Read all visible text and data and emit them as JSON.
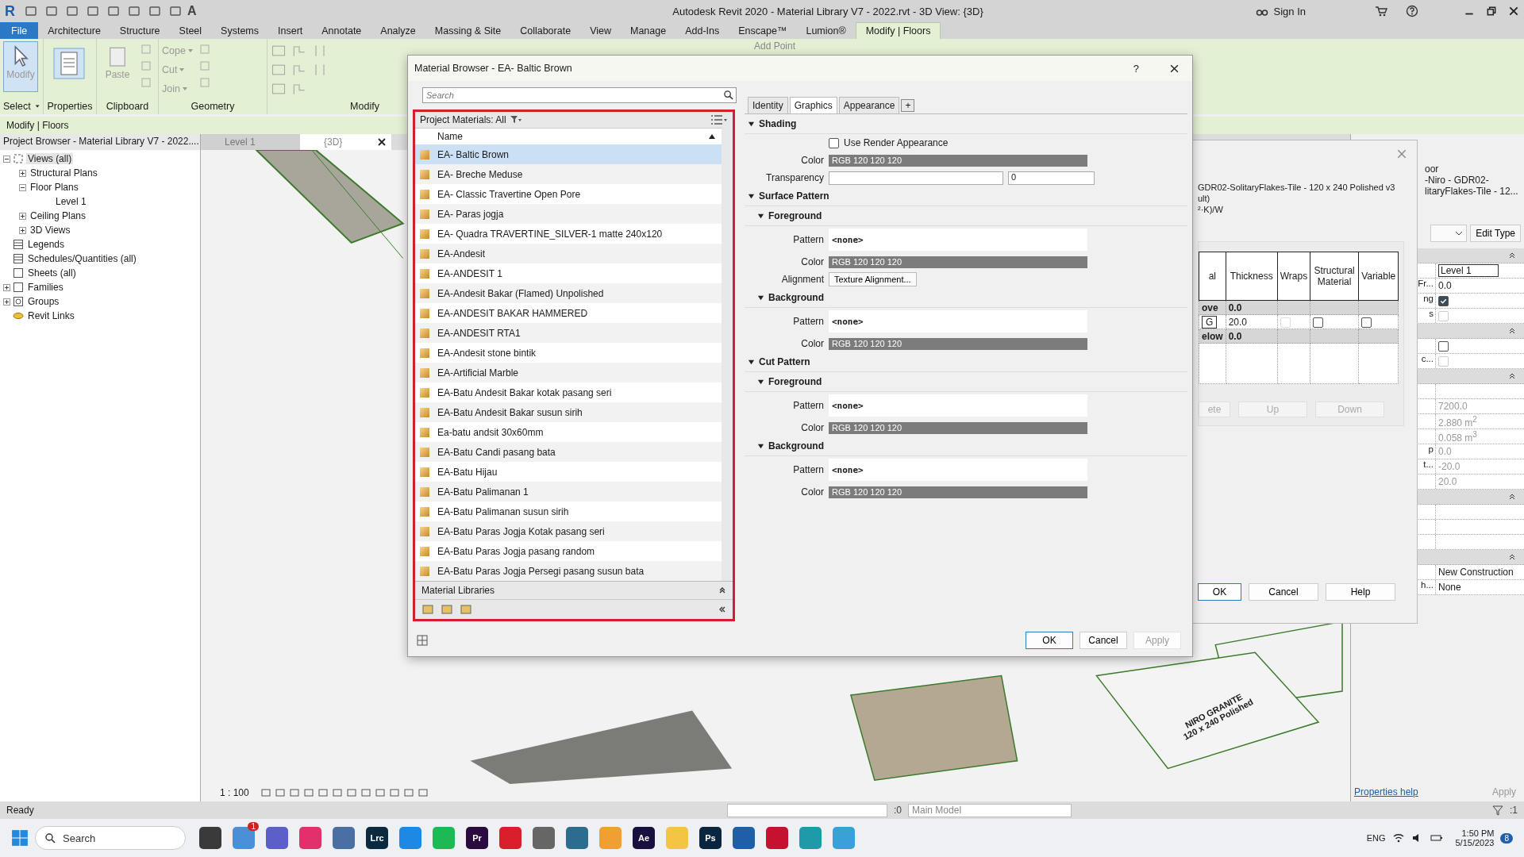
{
  "title_bar": {
    "logo": "R",
    "text_tool": "A",
    "title": "Autodesk Revit 2020 - Material Library V7 - 2022.rvt - 3D View: {3D}",
    "sign_in": "Sign In"
  },
  "ribbon_tabs": [
    {
      "label": "File",
      "kind": "file",
      "selected": false
    },
    {
      "label": "Architecture",
      "kind": "tab",
      "selected": false
    },
    {
      "label": "Structure",
      "kind": "tab",
      "selected": false
    },
    {
      "label": "Steel",
      "kind": "tab",
      "selected": false
    },
    {
      "label": "Systems",
      "kind": "tab",
      "selected": false
    },
    {
      "label": "Insert",
      "kind": "tab",
      "selected": false
    },
    {
      "label": "Annotate",
      "kind": "tab",
      "selected": false
    },
    {
      "label": "Analyze",
      "kind": "tab",
      "selected": false
    },
    {
      "label": "Massing & Site",
      "kind": "tab",
      "selected": false
    },
    {
      "label": "Collaborate",
      "kind": "tab",
      "selected": false
    },
    {
      "label": "View",
      "kind": "tab",
      "selected": false
    },
    {
      "label": "Manage",
      "kind": "tab",
      "selected": false
    },
    {
      "label": "Add-Ins",
      "kind": "tab",
      "selected": false
    },
    {
      "label": "Enscape™",
      "kind": "tab",
      "selected": false
    },
    {
      "label": "Lumion®",
      "kind": "tab",
      "selected": false
    },
    {
      "label": "Modify | Floors",
      "kind": "tab",
      "selected": true
    }
  ],
  "ribbon_panels": [
    {
      "label": "Select",
      "kind": "select",
      "tool": "Modify"
    },
    {
      "label": "Properties",
      "kind": "properties"
    },
    {
      "label": "Clipboard",
      "kind": "clipboard",
      "tool": "Paste"
    },
    {
      "label": "Geometry",
      "kind": "geometry",
      "small_tools": [
        "Cope",
        "Cut",
        "Join"
      ]
    },
    {
      "label": "Modify",
      "kind": "modify"
    }
  ],
  "ribbon_extra": "Add Point",
  "options_bar": "Modify | Floors",
  "project_browser": {
    "title": "Project Browser - Material Library V7 - 2022....",
    "tree": [
      {
        "label": "Views (all)",
        "kind": "views",
        "expanded": true,
        "selected": true,
        "children": [
          {
            "label": "Structural Plans",
            "expanded": false,
            "selected": false
          },
          {
            "label": "Floor Plans",
            "expanded": true,
            "selected": false,
            "children": [
              {
                "label": "Level 1",
                "selected": false
              }
            ]
          },
          {
            "label": "Ceiling Plans",
            "expanded": false,
            "selected": false
          },
          {
            "label": "3D Views",
            "expanded": false,
            "selected": false
          }
        ]
      },
      {
        "label": "Legends",
        "kind": "legend",
        "selected": false
      },
      {
        "label": "Schedules/Quantities (all)",
        "kind": "schedule",
        "selected": false
      },
      {
        "label": "Sheets (all)",
        "kind": "sheet",
        "selected": false
      },
      {
        "label": "Families",
        "kind": "family",
        "expanded": false,
        "selected": false
      },
      {
        "label": "Groups",
        "kind": "group",
        "expanded": false,
        "selected": false
      },
      {
        "label": "Revit Links",
        "kind": "link",
        "selected": false
      }
    ]
  },
  "view_tabs": [
    {
      "label": "Level 1",
      "selected": false
    },
    {
      "label": "{3D}",
      "selected": true
    }
  ],
  "view": {
    "tag_lines": [
      "NIRO GRANITE",
      "120 x 240 Polished"
    ],
    "scale": "1 : 100"
  },
  "material_browser": {
    "title": "Material Browser - EA- Baltic Brown",
    "help": "?",
    "search": {
      "placeholder": "Search"
    },
    "library_header": "Project Materials: All",
    "column": "Name",
    "materials": [
      {
        "name": "EA- Baltic Brown",
        "selected": true
      },
      {
        "name": "EA- Breche Meduse",
        "selected": false
      },
      {
        "name": "EA- Classic Travertine Open Pore",
        "selected": false
      },
      {
        "name": "EA- Paras jogja",
        "selected": false
      },
      {
        "name": "EA- Quadra TRAVERTINE_SILVER-1 matte 240x120",
        "selected": false
      },
      {
        "name": "EA-Andesit",
        "selected": false
      },
      {
        "name": "EA-ANDESIT 1",
        "selected": false
      },
      {
        "name": "EA-Andesit Bakar (Flamed) Unpolished",
        "selected": false
      },
      {
        "name": "EA-ANDESIT BAKAR HAMMERED",
        "selected": false
      },
      {
        "name": "EA-ANDESIT RTA1",
        "selected": false
      },
      {
        "name": "EA-Andesit stone bintik",
        "selected": false
      },
      {
        "name": "EA-Artificial Marble",
        "selected": false
      },
      {
        "name": "EA-Batu Andesit Bakar kotak pasang seri",
        "selected": false
      },
      {
        "name": "EA-Batu Andesit Bakar susun sirih",
        "selected": false
      },
      {
        "name": "Ea-batu andsit 30x60mm",
        "selected": false
      },
      {
        "name": "EA-Batu Candi pasang bata",
        "selected": false
      },
      {
        "name": "EA-Batu Hijau",
        "selected": false
      },
      {
        "name": "EA-Batu Palimanan 1",
        "selected": false
      },
      {
        "name": "EA-Batu Palimanan susun sirih",
        "selected": false
      },
      {
        "name": "EA-Batu Paras Jogja Kotak pasang seri",
        "selected": false
      },
      {
        "name": "EA-Batu Paras Jogja pasang random",
        "selected": false
      },
      {
        "name": "EA-Batu Paras Jogja Persegi pasang susun bata",
        "selected": false
      }
    ],
    "libraries": "Material Libraries",
    "tabs": [
      {
        "label": "Identity",
        "selected": false
      },
      {
        "label": "Graphics",
        "selected": true
      },
      {
        "label": "Appearance",
        "selected": false
      }
    ],
    "add_tab": "+",
    "sections": [
      {
        "title": "Shading",
        "expanded": true,
        "rows": [
          {
            "kind": "checkbox",
            "label": "Use Render Appearance",
            "checked": false
          },
          {
            "kind": "color",
            "label": "Color",
            "value": "RGB 120 120 120"
          },
          {
            "kind": "slider",
            "label": "Transparency",
            "value": "0",
            "level": 0
          }
        ]
      },
      {
        "title": "Surface Pattern",
        "expanded": true,
        "groups": [
          {
            "title": "Foreground",
            "expanded": true,
            "rows": [
              {
                "kind": "pattern",
                "label": "Pattern",
                "value": "<none>"
              },
              {
                "kind": "color",
                "label": "Color",
                "value": "RGB 120 120 120"
              },
              {
                "kind": "button",
                "label": "Alignment",
                "value": "Texture Alignment..."
              }
            ]
          },
          {
            "title": "Background",
            "expanded": true,
            "rows": [
              {
                "kind": "pattern",
                "label": "Pattern",
                "value": "<none>"
              },
              {
                "kind": "color",
                "label": "Color",
                "value": "RGB 120 120 120"
              }
            ]
          }
        ]
      },
      {
        "title": "Cut Pattern",
        "expanded": true,
        "groups": [
          {
            "title": "Foreground",
            "expanded": true,
            "rows": [
              {
                "kind": "pattern",
                "label": "Pattern",
                "value": "<none>"
              },
              {
                "kind": "color",
                "label": "Color",
                "value": "RGB 120 120 120"
              }
            ]
          },
          {
            "title": "Background",
            "expanded": true,
            "rows": [
              {
                "kind": "pattern",
                "label": "Pattern",
                "value": "<none>"
              },
              {
                "kind": "color",
                "label": "Color",
                "value": "RGB 120 120 120"
              }
            ]
          }
        ]
      }
    ],
    "buttons": [
      {
        "label": "OK",
        "disabled": false
      },
      {
        "label": "Cancel",
        "disabled": false
      },
      {
        "label": "Apply",
        "disabled": true
      }
    ]
  },
  "assembly_dialog": {
    "lines": [
      "GDR02-SolitaryFlakes-Tile - 120 x 240 Polished v3",
      "ult)",
      "²·K)/W"
    ],
    "columns": [
      "al",
      "Thickness",
      "Wraps",
      "Structural Material",
      "Variable"
    ],
    "layers": [
      {
        "kind": "boundary",
        "name": "ove",
        "thickness": "0.0"
      },
      {
        "kind": "layer",
        "name": "G",
        "thickness": "20.0",
        "wraps": {
          "checked": false,
          "disabled": true
        },
        "structural": {
          "checked": false,
          "disabled": false
        },
        "variable": {
          "checked": false,
          "disabled": false
        }
      },
      {
        "kind": "boundary",
        "name": "elow",
        "thickness": "0.0"
      }
    ],
    "row_buttons": [
      {
        "label": "ete",
        "disabled": true
      },
      {
        "label": "Up",
        "disabled": true
      },
      {
        "label": "Down",
        "disabled": true
      }
    ],
    "buttons": [
      {
        "label": "OK",
        "selected": true
      },
      {
        "label": "Cancel",
        "selected": false
      },
      {
        "label": "Help",
        "selected": false
      }
    ]
  },
  "properties": {
    "type_lines": [
      "oor",
      "-Niro - GDR02-",
      "litaryFlakes-Tile - 12..."
    ],
    "edit_type": "Edit Type",
    "rows": [
      {
        "kind": "header"
      },
      {
        "kind": "value",
        "value": "Level 1",
        "disabled": false,
        "boxed": true
      },
      {
        "kind": "value",
        "label": "Fr...",
        "value": "0.0",
        "disabled": false
      },
      {
        "kind": "checkbox",
        "label": "ng",
        "checked": true,
        "disabled": false
      },
      {
        "kind": "checkbox",
        "label": "s",
        "checked": false,
        "disabled": true
      },
      {
        "kind": "header"
      },
      {
        "kind": "checkbox",
        "checked": false,
        "disabled": false
      },
      {
        "kind": "checkbox",
        "label": "c...",
        "checked": false,
        "disabled": true
      },
      {
        "kind": "header"
      },
      {
        "kind": "empty"
      },
      {
        "kind": "value",
        "value": "7200.0",
        "disabled": true
      },
      {
        "kind": "value",
        "value": "2.880 m$^{2}$",
        "disabled": true
      },
      {
        "kind": "value",
        "value": "0.058 m$^{3}$",
        "disabled": true
      },
      {
        "kind": "value",
        "label": "p",
        "value": "0.0",
        "disabled": true
      },
      {
        "kind": "value",
        "label": "t...",
        "value": "-20.0",
        "disabled": true
      },
      {
        "kind": "value",
        "value": "20.0",
        "disabled": true
      },
      {
        "kind": "header"
      },
      {
        "kind": "empty"
      },
      {
        "kind": "empty"
      },
      {
        "kind": "empty"
      },
      {
        "kind": "header"
      },
      {
        "kind": "value",
        "value": "New Construction",
        "disabled": false
      },
      {
        "kind": "value",
        "label": "h...",
        "value": "None",
        "disabled": false
      }
    ],
    "help": "Properties help",
    "apply": "Apply"
  },
  "status_bar": {
    "message": "Ready",
    "count": ":0",
    "model": "Main Model",
    "filter": ":1"
  },
  "taskbar": {
    "search": {
      "placeholder": "Search"
    },
    "apps": [
      {
        "color": "#3a3a3a"
      },
      {
        "color": "#4a90d9",
        "badge": "1"
      },
      {
        "color": "#5b5fc7"
      },
      {
        "color": "#e1306c"
      },
      {
        "color": "#4a6fa5"
      },
      {
        "color": "#0b2a3f",
        "label": "Lrc"
      },
      {
        "color": "#1e88e5"
      },
      {
        "color": "#1db954"
      },
      {
        "color": "#2a0a3f",
        "label": "Pr"
      },
      {
        "color": "#d81e2a"
      },
      {
        "color": "#666666"
      },
      {
        "color": "#2b6c8f"
      },
      {
        "color": "#f0a030"
      },
      {
        "color": "#1a1040",
        "label": "Ae"
      },
      {
        "color": "#f4c542"
      },
      {
        "color": "#0a2540",
        "label": "Ps"
      },
      {
        "color": "#1f5fa8"
      },
      {
        "color": "#c41230"
      },
      {
        "color": "#1f9aa8"
      },
      {
        "color": "#3aa0d8"
      }
    ],
    "language": "ENG",
    "time": "1:50 PM",
    "date": "5/15/2023",
    "notifications": "8"
  }
}
